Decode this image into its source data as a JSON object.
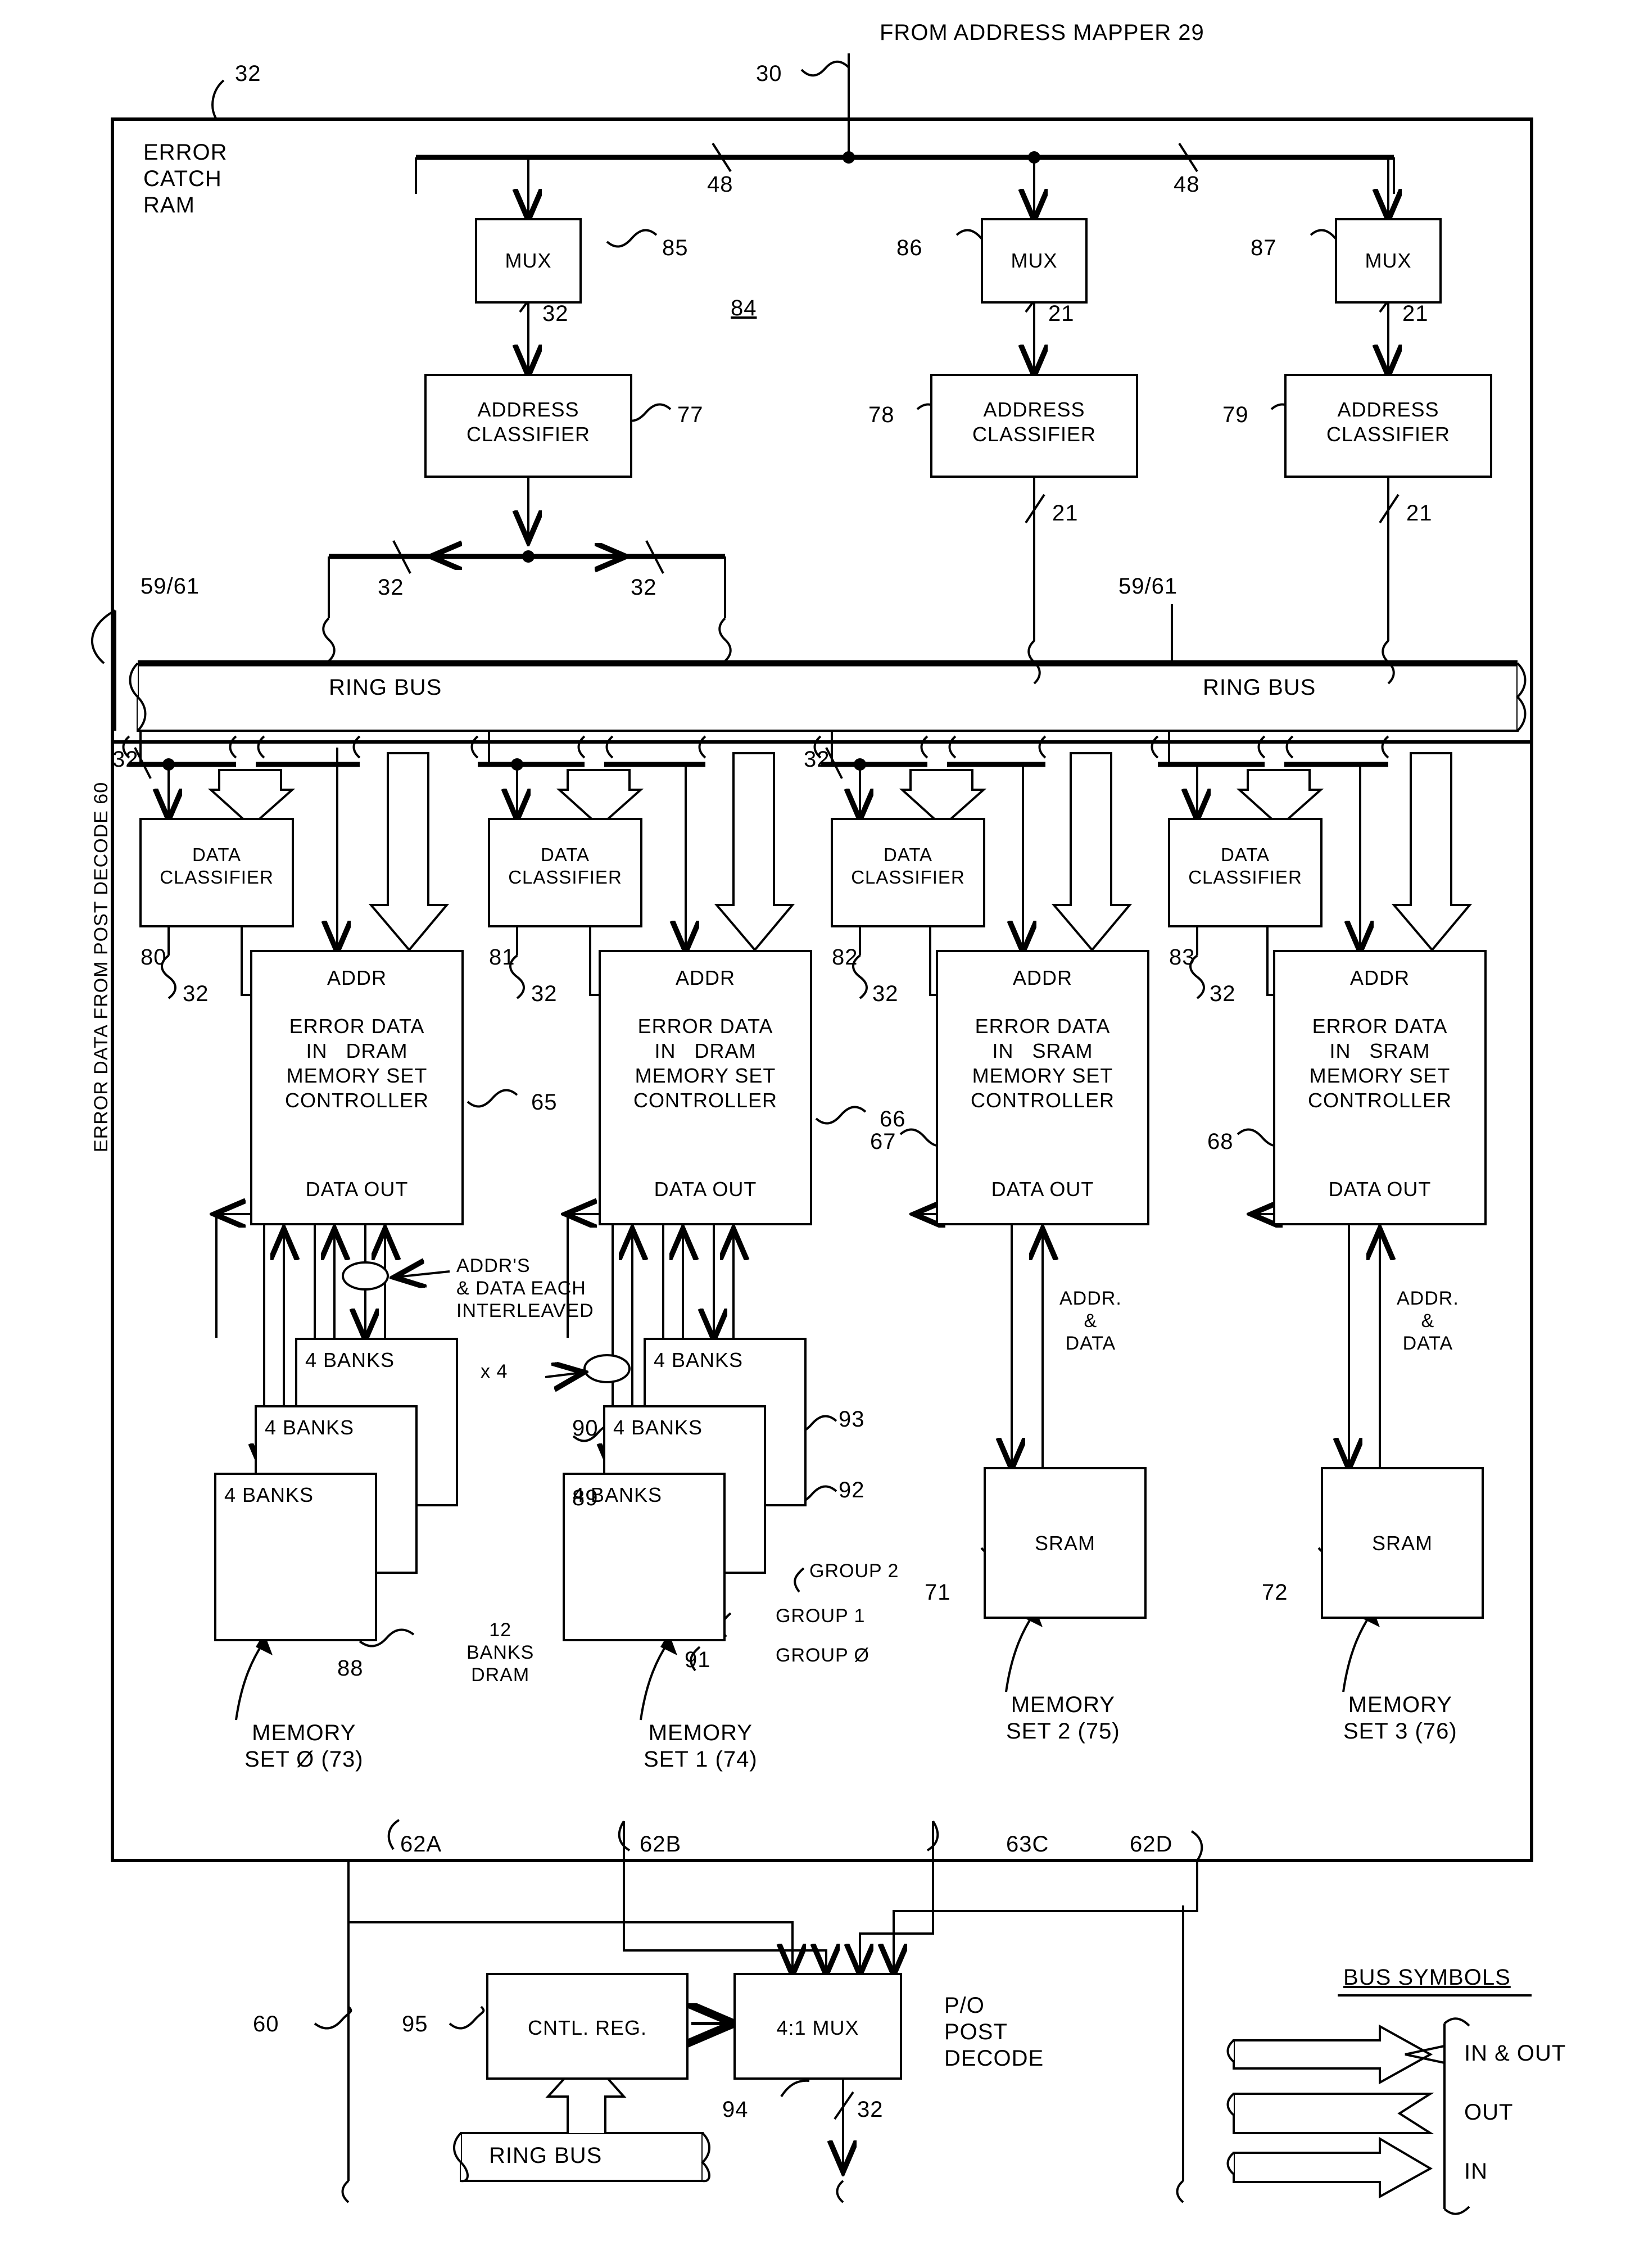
{
  "figure": {
    "outer_block_label": "ERROR\nCATCH\nRAM",
    "outer_block_ref": "32",
    "source_label": "FROM ADDRESS MAPPER 29",
    "source_ref": "30",
    "left_vertical_label": "ERROR DATA FROM POST DECODE 60",
    "mux_group_ref": "84",
    "bus_symbols_title": "BUS SYMBOLS"
  },
  "top_bus": {
    "width_labels": [
      "48",
      "48"
    ]
  },
  "muxes": [
    {
      "label": "MUX",
      "ref": "85",
      "out_width": "32"
    },
    {
      "label": "MUX",
      "ref": "86",
      "out_width": "21"
    },
    {
      "label": "MUX",
      "ref": "87",
      "out_width": "21"
    }
  ],
  "address_classifiers": [
    {
      "label": "ADDRESS\nCLASSIFIER",
      "ref": "77",
      "out_widths": [
        "32",
        "32"
      ]
    },
    {
      "label": "ADDRESS\nCLASSIFIER",
      "ref": "78",
      "out_widths": [
        "21"
      ]
    },
    {
      "label": "ADDRESS\nCLASSIFIER",
      "ref": "79",
      "out_widths": [
        "21"
      ]
    }
  ],
  "ring_bus": {
    "left_label": "RING BUS",
    "right_label": "RING BUS",
    "left_ref": "59/61",
    "right_ref": "59/61",
    "tap_width": "32"
  },
  "data_classifiers": [
    {
      "label": "DATA\nCLASSIFIER",
      "ref": "80",
      "width": "32"
    },
    {
      "label": "DATA\nCLASSIFIER",
      "ref": "81",
      "width": "32"
    },
    {
      "label": "DATA\nCLASSIFIER",
      "ref": "82",
      "width": "32"
    },
    {
      "label": "DATA\nCLASSIFIER",
      "ref": "83",
      "width": "32"
    }
  ],
  "controllers": [
    {
      "top": "ADDR",
      "body": "ERROR DATA\nIN   DRAM\nMEMORY SET\nCONTROLLER",
      "bottom": "DATA OUT",
      "ref": "65"
    },
    {
      "top": "ADDR",
      "body": "ERROR DATA\nIN   DRAM\nMEMORY SET\nCONTROLLER",
      "bottom": "DATA OUT",
      "ref": "66"
    },
    {
      "top": "ADDR",
      "body": "ERROR DATA\nIN   SRAM\nMEMORY SET\nCONTROLLER",
      "bottom": "DATA OUT",
      "ref": "67"
    },
    {
      "top": "ADDR",
      "body": "ERROR DATA\nIN   SRAM\nMEMORY SET\nCONTROLLER",
      "bottom": "DATA OUT",
      "ref": "68"
    }
  ],
  "annotations": {
    "interleave_note": "ADDR'S\n& DATA EACH\nINTERLEAVED",
    "times_four": "x 4",
    "dram_total_note": "12\nBANKS\nDRAM",
    "addr_data_note": "ADDR.\n&\nDATA"
  },
  "banks": {
    "label": "4 BANKS",
    "set0_refs": [
      "88",
      "89",
      "90"
    ],
    "set1_refs": [
      "91",
      "92",
      "93"
    ],
    "groups": [
      "GROUP 2",
      "GROUP 1",
      "GROUP Ø"
    ]
  },
  "srams": [
    {
      "label": "SRAM",
      "ref": "71"
    },
    {
      "label": "SRAM",
      "ref": "72"
    }
  ],
  "memory_sets": [
    {
      "label": "MEMORY\nSET Ø (73)"
    },
    {
      "label": "MEMORY\nSET 1 (74)"
    },
    {
      "label": "MEMORY\nSET 2 (75)"
    },
    {
      "label": "MEMORY\nSET 3 (76)"
    }
  ],
  "output_refs": [
    "62A",
    "62B",
    "63C",
    "62D"
  ],
  "bottom": {
    "post_decode_ref": "60",
    "cntl_reg_label": "CNTL. REG.",
    "cntl_reg_ref": "95",
    "mux_label": "4:1 MUX",
    "mux_ref": "94",
    "mux_out_width": "32",
    "po_label": "P/O\nPOST\nDECODE",
    "ring_bus_label": "RING BUS"
  },
  "bus_symbols": [
    {
      "label": "IN & OUT"
    },
    {
      "label": "OUT"
    },
    {
      "label": "IN"
    }
  ]
}
